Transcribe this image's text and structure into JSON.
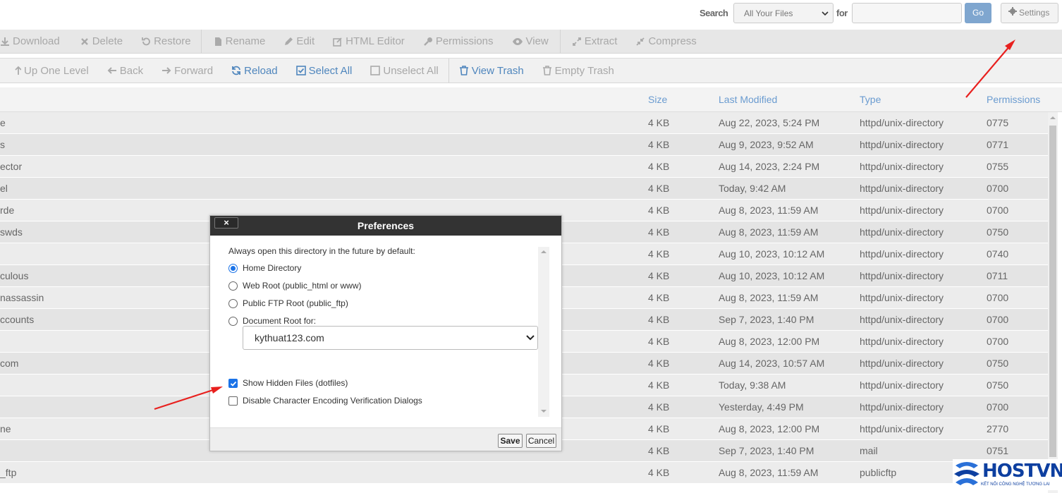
{
  "search": {
    "label": "Search",
    "scope_value": "All Your Files",
    "for_label": "for",
    "query_value": "",
    "go_label": "Go",
    "settings_label": "Settings"
  },
  "toolbar_actions": [
    "Download",
    "Delete",
    "Restore",
    "Rename",
    "Edit",
    "HTML Editor",
    "Permissions",
    "View",
    "Extract",
    "Compress"
  ],
  "toolbar_nav": [
    "Up One Level",
    "Back",
    "Forward",
    "Reload",
    "Select All",
    "Unselect All",
    "View Trash",
    "Empty Trash"
  ],
  "table": {
    "headers": {
      "size": "Size",
      "modified": "Last Modified",
      "type": "Type",
      "permissions": "Permissions"
    },
    "rows": [
      {
        "name": "e",
        "size": "4 KB",
        "modified": "Aug 22, 2023, 5:24 PM",
        "type": "httpd/unix-directory",
        "perm": "0775"
      },
      {
        "name": "s",
        "size": "4 KB",
        "modified": "Aug 9, 2023, 9:52 AM",
        "type": "httpd/unix-directory",
        "perm": "0771"
      },
      {
        "name": "ector",
        "size": "4 KB",
        "modified": "Aug 14, 2023, 2:24 PM",
        "type": "httpd/unix-directory",
        "perm": "0755"
      },
      {
        "name": "el",
        "size": "4 KB",
        "modified": "Today, 9:42 AM",
        "type": "httpd/unix-directory",
        "perm": "0700"
      },
      {
        "name": "rde",
        "size": "4 KB",
        "modified": "Aug 8, 2023, 11:59 AM",
        "type": "httpd/unix-directory",
        "perm": "0700"
      },
      {
        "name": "swds",
        "size": "4 KB",
        "modified": "Aug 8, 2023, 11:59 AM",
        "type": "httpd/unix-directory",
        "perm": "0750"
      },
      {
        "name": "",
        "size": "4 KB",
        "modified": "Aug 10, 2023, 10:12 AM",
        "type": "httpd/unix-directory",
        "perm": "0740"
      },
      {
        "name": "culous",
        "size": "4 KB",
        "modified": "Aug 10, 2023, 10:12 AM",
        "type": "httpd/unix-directory",
        "perm": "0711"
      },
      {
        "name": "nassassin",
        "size": "4 KB",
        "modified": "Aug 8, 2023, 11:59 AM",
        "type": "httpd/unix-directory",
        "perm": "0700"
      },
      {
        "name": "ccounts",
        "size": "4 KB",
        "modified": "Sep 7, 2023, 1:40 PM",
        "type": "httpd/unix-directory",
        "perm": "0700"
      },
      {
        "name": "",
        "size": "4 KB",
        "modified": "Aug 8, 2023, 12:00 PM",
        "type": "httpd/unix-directory",
        "perm": "0700"
      },
      {
        "name": "com",
        "size": "4 KB",
        "modified": "Aug 14, 2023, 10:57 AM",
        "type": "httpd/unix-directory",
        "perm": "0750"
      },
      {
        "name": "",
        "size": "4 KB",
        "modified": "Today, 9:38 AM",
        "type": "httpd/unix-directory",
        "perm": "0750"
      },
      {
        "name": "",
        "size": "4 KB",
        "modified": "Yesterday, 4:49 PM",
        "type": "httpd/unix-directory",
        "perm": "0700"
      },
      {
        "name": "ne",
        "size": "4 KB",
        "modified": "Aug 8, 2023, 12:00 PM",
        "type": "httpd/unix-directory",
        "perm": "2770"
      },
      {
        "name": "",
        "size": "4 KB",
        "modified": "Sep 7, 2023, 1:40 PM",
        "type": "mail",
        "perm": "0751"
      },
      {
        "name": "_ftp",
        "size": "4 KB",
        "modified": "Aug 8, 2023, 11:59 AM",
        "type": "publicftp",
        "perm": ""
      }
    ]
  },
  "dialog": {
    "title": "Preferences",
    "close_label": "×",
    "intro": "Always open this directory in the future by default:",
    "radios": [
      {
        "label": "Home Directory",
        "checked": true
      },
      {
        "label": "Web Root (public_html or www)",
        "checked": false
      },
      {
        "label": "Public FTP Root (public_ftp)",
        "checked": false
      },
      {
        "label": "Document Root for:",
        "checked": false
      }
    ],
    "docroot_value": "kythuat123.com",
    "checkboxes": [
      {
        "label": "Show Hidden Files (dotfiles)",
        "checked": true
      },
      {
        "label": "Disable Character Encoding Verification Dialogs",
        "checked": false
      }
    ],
    "save_label": "Save",
    "cancel_label": "Cancel"
  },
  "logo": {
    "text": "HOSTVN",
    "tagline": "KẾT NỐI CÔNG NGHỆ TƯƠNG LAI"
  },
  "colors": {
    "accent": "#4f86bd",
    "dialog_header": "#333333",
    "arrow": "#e8201e",
    "logo": "#0d3fa0"
  }
}
